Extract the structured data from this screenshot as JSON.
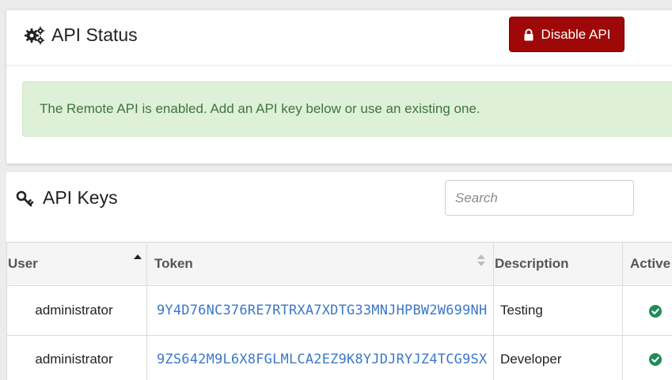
{
  "status_panel": {
    "title": "API Status",
    "title_icon": "gears-icon",
    "disable_button": {
      "label": "Disable API",
      "icon": "lock-icon",
      "color": "#9e0808"
    },
    "alert_text": "The Remote API is enabled. Add an API key below or use an existing one.",
    "alert_color": "#dff0d8"
  },
  "keys_panel": {
    "title": "API Keys",
    "title_icon": "key-icon",
    "search": {
      "placeholder": "Search",
      "value": ""
    },
    "columns": [
      {
        "label": "User",
        "sort": "ascending"
      },
      {
        "label": "Token",
        "sort": "none"
      },
      {
        "label": "Description",
        "sort": "none"
      },
      {
        "label": "Active",
        "sort": "none"
      }
    ],
    "rows": [
      {
        "user": "administrator",
        "token": "9Y4D76NC376RE7RTRXA7XDTG33MNJHPBW2W699NH",
        "description": "Testing",
        "active": true
      },
      {
        "user": "administrator",
        "token": "9ZS642M9L6X8FGLMLCA2EZ9K8YJDJRYJZ4TCG9SX",
        "description": "Developer",
        "active": true
      }
    ],
    "token_color": "#3d78c7",
    "active_color": "#1e8a5a"
  }
}
